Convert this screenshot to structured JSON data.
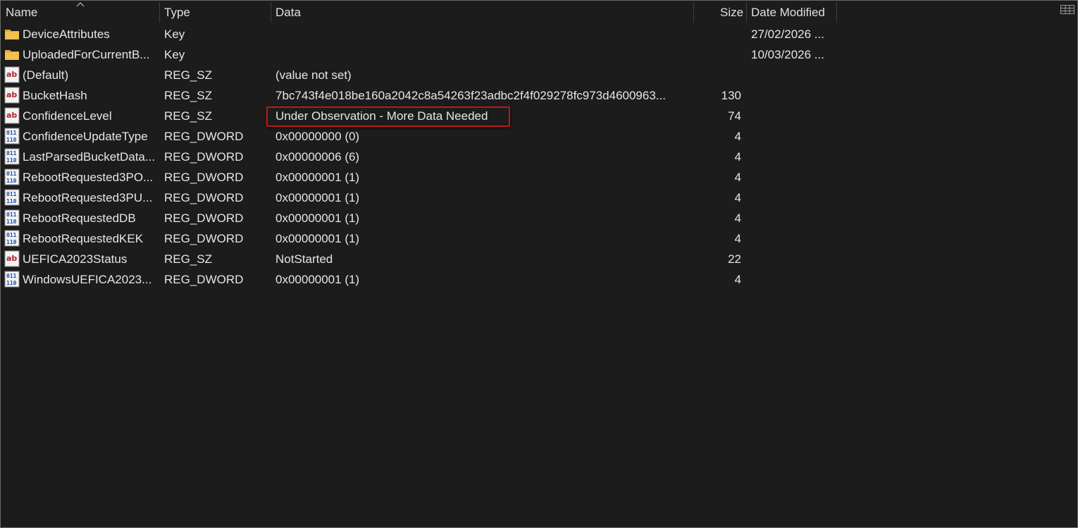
{
  "columns": {
    "name": "Name",
    "type": "Type",
    "data": "Data",
    "size": "Size",
    "date_modified": "Date Modified"
  },
  "icons": {
    "sort": "chevron-up-icon",
    "view_toggle": "grid-view-icon",
    "key": "folder-icon",
    "string": "reg-sz-icon",
    "binary": "reg-dword-icon"
  },
  "colors": {
    "background": "#1c1c1c",
    "highlight_border": "#c0161a",
    "folder": "#f2c14e",
    "reg_sz": "#b3202c",
    "reg_dword": "#1f4fa8"
  },
  "rows": [
    {
      "icon": "folder",
      "name": "DeviceAttributes",
      "type": "Key",
      "data": "",
      "size": "",
      "date": "27/02/2026 ..."
    },
    {
      "icon": "folder",
      "name": "UploadedForCurrentB...",
      "type": "Key",
      "data": "",
      "size": "",
      "date": "10/03/2026 ..."
    },
    {
      "icon": "sz",
      "name": "(Default)",
      "type": "REG_SZ",
      "data": "(value not set)",
      "size": "",
      "date": ""
    },
    {
      "icon": "sz",
      "name": "BucketHash",
      "type": "REG_SZ",
      "data": "7bc743f4e018be160a2042c8a54263f23adbc2f4f029278fc973d4600963...",
      "size": "130",
      "date": ""
    },
    {
      "icon": "sz",
      "name": "ConfidenceLevel",
      "type": "REG_SZ",
      "data": "Under Observation - More Data Needed",
      "size": "74",
      "date": ""
    },
    {
      "icon": "dword",
      "name": "ConfidenceUpdateType",
      "type": "REG_DWORD",
      "data": "0x00000000 (0)",
      "size": "4",
      "date": ""
    },
    {
      "icon": "dword",
      "name": "LastParsedBucketData...",
      "type": "REG_DWORD",
      "data": "0x00000006 (6)",
      "size": "4",
      "date": ""
    },
    {
      "icon": "dword",
      "name": "RebootRequested3PO...",
      "type": "REG_DWORD",
      "data": "0x00000001 (1)",
      "size": "4",
      "date": ""
    },
    {
      "icon": "dword",
      "name": "RebootRequested3PU...",
      "type": "REG_DWORD",
      "data": "0x00000001 (1)",
      "size": "4",
      "date": ""
    },
    {
      "icon": "dword",
      "name": "RebootRequestedDB",
      "type": "REG_DWORD",
      "data": "0x00000001 (1)",
      "size": "4",
      "date": ""
    },
    {
      "icon": "dword",
      "name": "RebootRequestedKEK",
      "type": "REG_DWORD",
      "data": "0x00000001 (1)",
      "size": "4",
      "date": ""
    },
    {
      "icon": "sz",
      "name": "UEFICA2023Status",
      "type": "REG_SZ",
      "data": "NotStarted",
      "size": "22",
      "date": ""
    },
    {
      "icon": "dword",
      "name": "WindowsUEFICA2023...",
      "type": "REG_DWORD",
      "data": "0x00000001 (1)",
      "size": "4",
      "date": ""
    }
  ]
}
